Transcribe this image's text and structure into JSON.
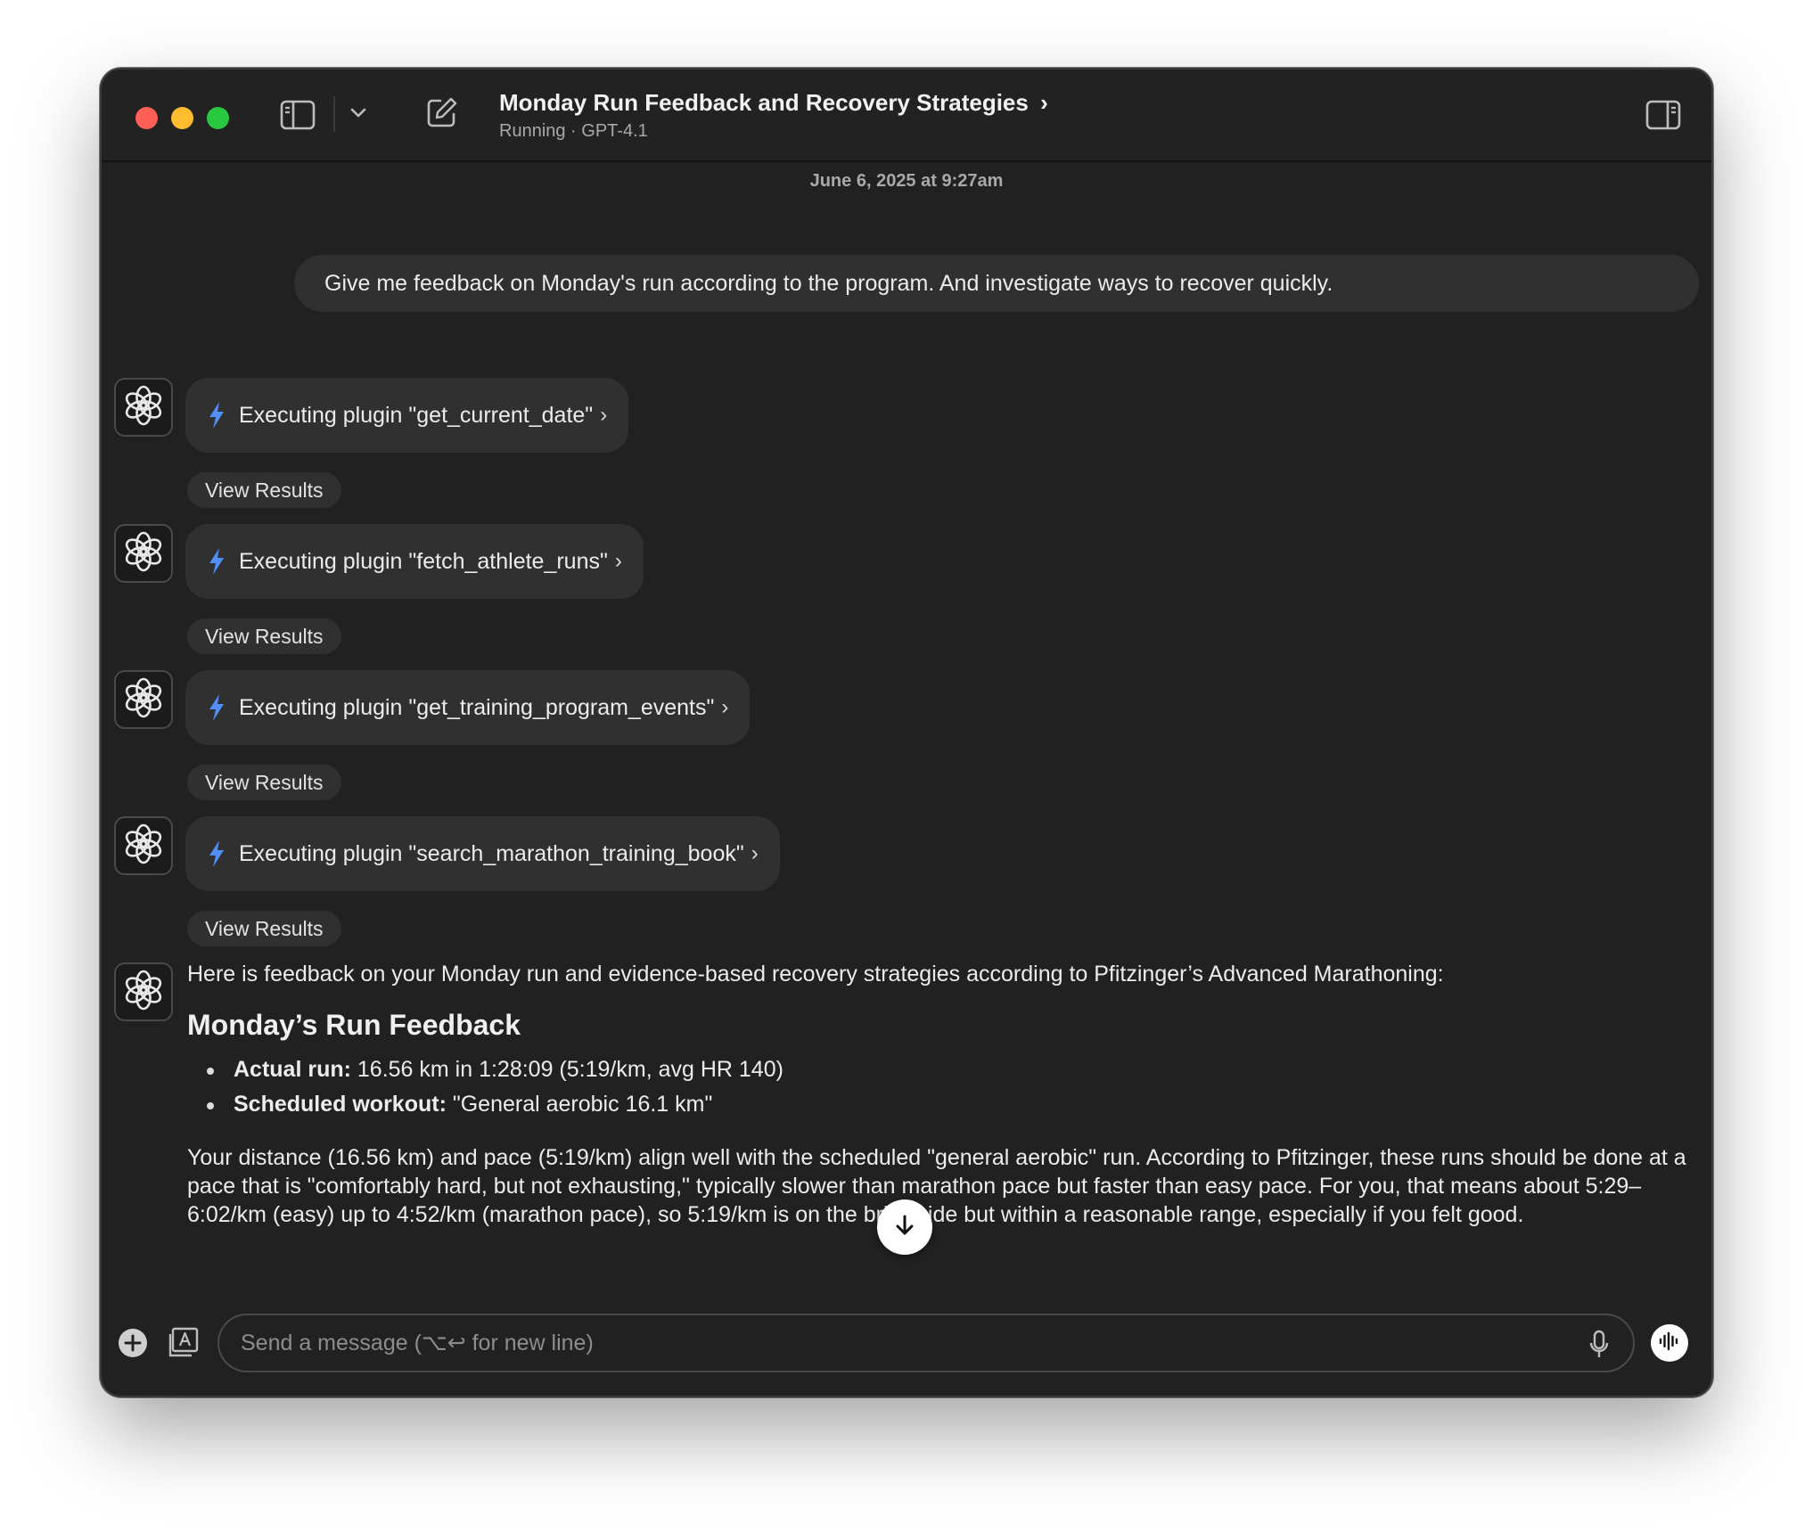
{
  "header": {
    "title": "Monday Run Feedback and Recovery Strategies",
    "title_chevron": "›",
    "subtitle": "Running · GPT-4.1"
  },
  "timestamp": "June 6, 2025 at 9:27am",
  "user_message": "Give me feedback on Monday's run according to the program. And investigate ways to recover quickly.",
  "plugins": [
    {
      "label": "Executing plugin \"get_current_date\"",
      "view_results": "View Results"
    },
    {
      "label": "Executing plugin \"fetch_athlete_runs\"",
      "view_results": "View Results"
    },
    {
      "label": "Executing plugin \"get_training_program_events\"",
      "view_results": "View Results"
    },
    {
      "label": "Executing plugin \"search_marathon_training_book\"",
      "view_results": "View Results"
    }
  ],
  "plugin_chevron": "›",
  "answer": {
    "intro": "Here is feedback on your Monday run and evidence-based recovery strategies according to Pfitzinger’s Advanced Marathoning:",
    "heading": "Monday’s Run Feedback",
    "bullets": [
      {
        "label": "Actual run:",
        "text": " 16.56 km in 1:28:09 (5:19/km, avg HR 140)"
      },
      {
        "label": "Scheduled workout:",
        "text": " \"General aerobic 16.1 km\""
      }
    ],
    "paragraph": "Your distance (16.56 km) and pace (5:19/km) align well with the scheduled \"general aerobic\" run. According to Pfitzinger, these runs should be done at a pace that is \"comfortably hard, but not exhausting,\" typically slower than marathon pace but faster than easy pace. For you, that means about 5:29–6:02/km (easy) up to 4:52/km (marathon pace), so 5:19/km is on the brisk side but within a reasonable range, especially if you felt good."
  },
  "composer": {
    "placeholder": "Send a message (⌥↩ for new line)"
  },
  "icons": {
    "sidebar_toggle": "sidebar-icon",
    "dropdown": "chevron-down-icon",
    "new_chat": "compose-icon",
    "right_panel": "right-panel-icon",
    "bolt": "bolt-icon",
    "avatar": "openai-logo-icon",
    "scroll_down": "arrow-down-icon",
    "plus": "plus-icon",
    "library": "library-icon",
    "mic": "microphone-icon",
    "voice": "voice-mode-icon"
  },
  "colors": {
    "window_bg": "#212121",
    "bubble_bg": "#303030",
    "bolt": "#4f8ff7",
    "text": "#ececec",
    "muted": "#a8a8a8"
  }
}
